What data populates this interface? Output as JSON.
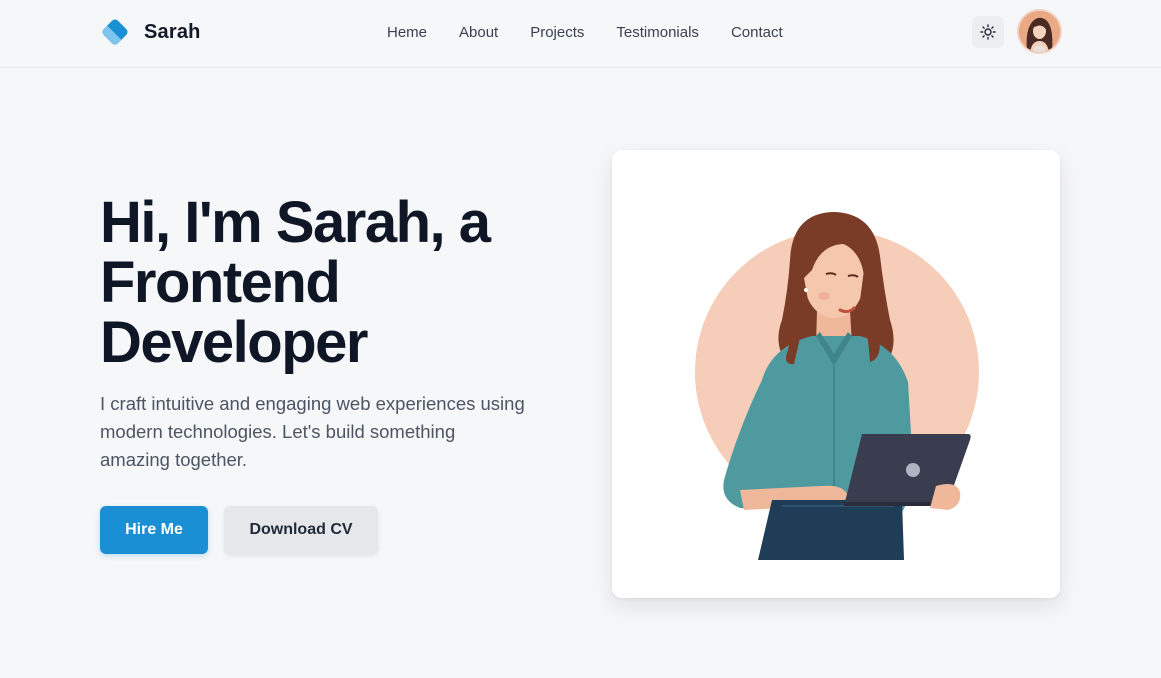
{
  "brand": {
    "name": "Sarah",
    "logo_icon": "tilted-square-logo-icon",
    "accent_color": "#1a8fd4"
  },
  "nav": {
    "items": [
      {
        "label": "Heme"
      },
      {
        "label": "About"
      },
      {
        "label": "Projects"
      },
      {
        "label": "Testimonials"
      },
      {
        "label": "Contact"
      }
    ]
  },
  "header_actions": {
    "theme_icon": "sun-icon",
    "avatar_icon": "user-avatar"
  },
  "hero": {
    "title_lines": [
      "Hi, I'm Sarah, a",
      "Frontend",
      "Developer"
    ],
    "subtitle_lines": [
      "I craft intuitive and engaging web experiences using",
      "modern technologies. Let's build something",
      "amazing together."
    ],
    "primary_button": "Hire Me",
    "secondary_button": "Download CV"
  },
  "illustration": {
    "subject": "woman-with-laptop-illustration",
    "circle_color": "#f6cdb8",
    "shirt_color": "#4f9a9e",
    "hair_color": "#7a3b27",
    "laptop_color": "#3a3d50"
  }
}
